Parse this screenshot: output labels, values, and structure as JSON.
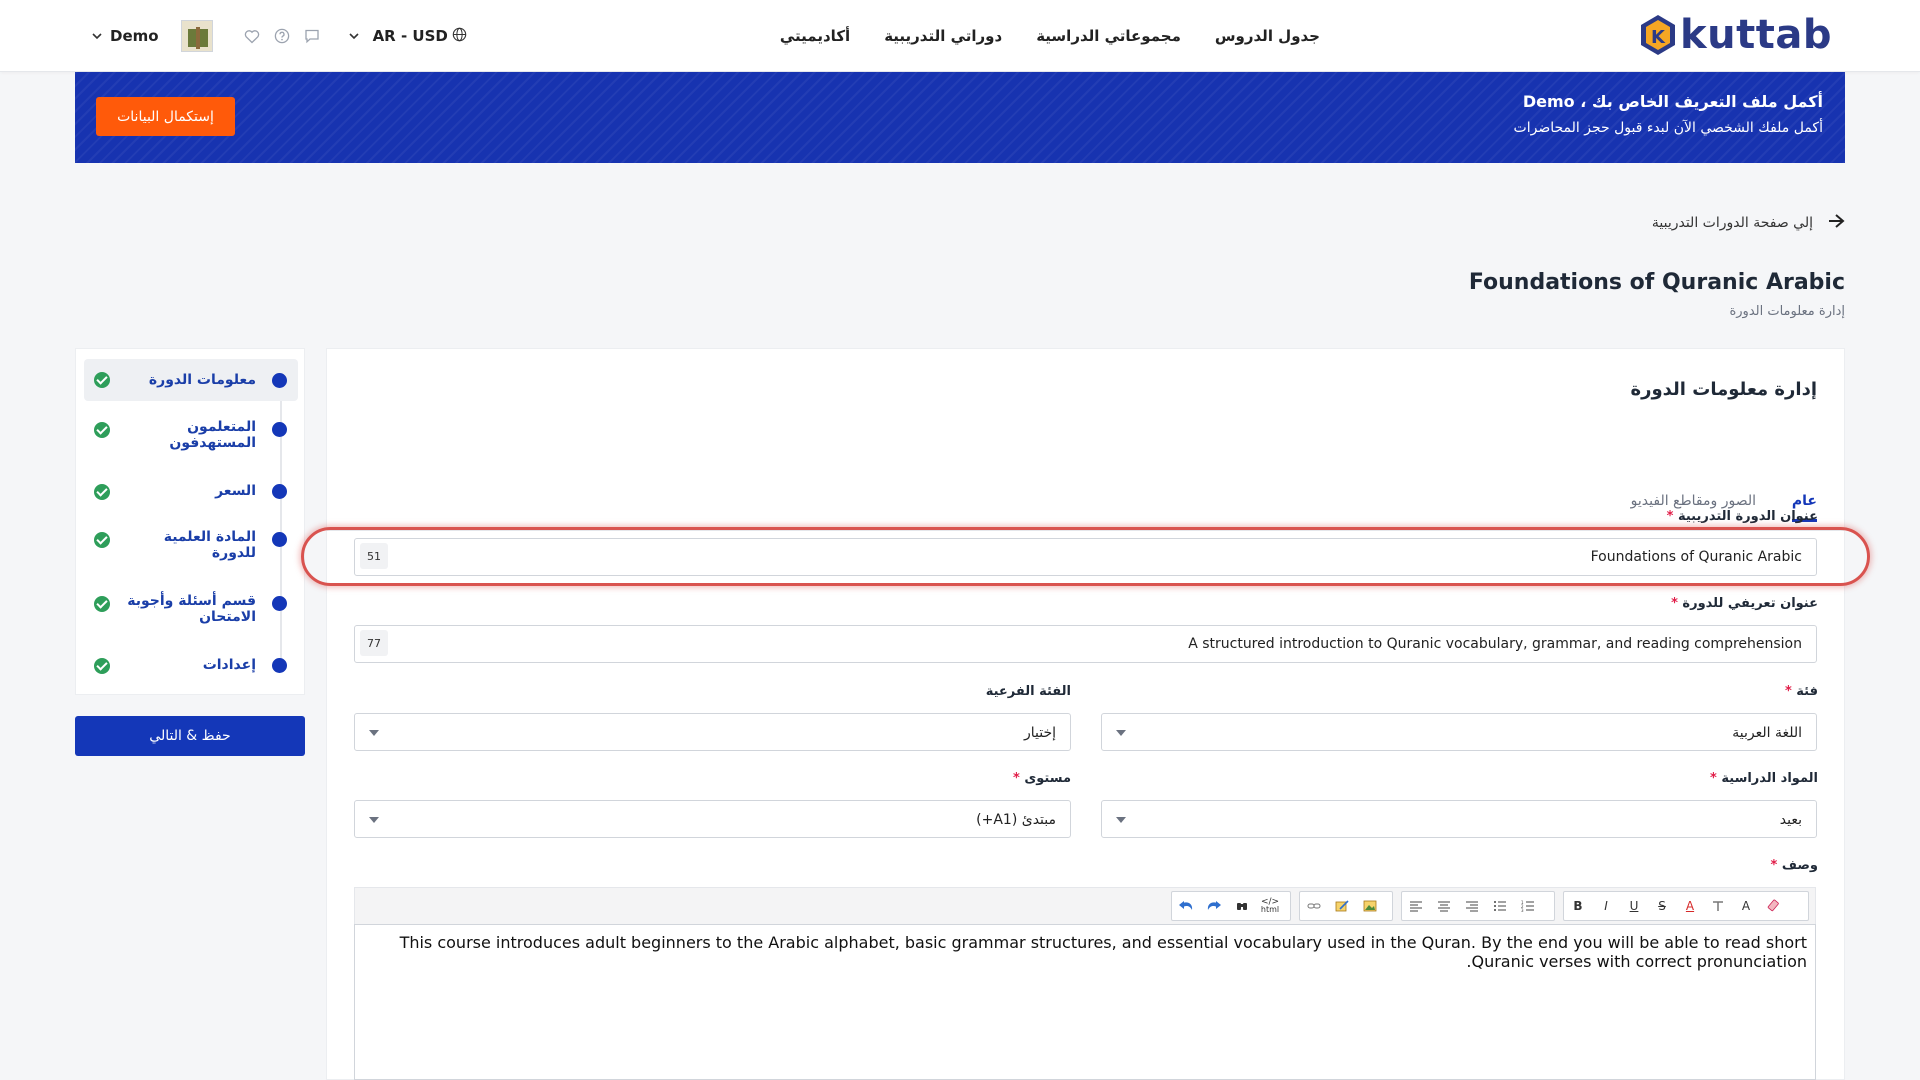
{
  "nav": {
    "logo_text": "kuttab",
    "logo_mark": "K",
    "links": [
      "جدول الدروس",
      "مجموعاتي الدراسية",
      "دوراتي التدريبية",
      "أكاديميتي"
    ],
    "language": "AR - USD",
    "user_name": "Demo",
    "icons": [
      "globe-icon",
      "chat-icon",
      "help-icon",
      "heart-icon",
      "chevron-down-icon"
    ]
  },
  "banner": {
    "title": "أكمل ملف التعريف الخاص بك ، Demo",
    "subtitle": "أكمل ملفك الشخصي الآن لبدء قبول حجز المحاضرات",
    "button": "إستكمال البيانات",
    "bg_color": "#1733b0",
    "button_color": "#ff5a0a"
  },
  "back_link": "إلي صفحة الدورات التدريبية",
  "page": {
    "title": "Foundations of Quranic Arabic",
    "subtitle": "إدارة معلومات الدورة"
  },
  "sidebar": {
    "items": [
      {
        "label": "معلومات الدورة"
      },
      {
        "label": "المتعلمون المستهدفون"
      },
      {
        "label": "السعر"
      },
      {
        "label": "المادة العلمية للدورة"
      },
      {
        "label": "قسم أسئلة وأجوبة الامتحان"
      },
      {
        "label": "إعدادات"
      }
    ],
    "save_button": "حفظ & التالي"
  },
  "card": {
    "title": "إدارة معلومات الدورة",
    "tabs": [
      "عام",
      "الصور ومقاطع الفيديو"
    ]
  },
  "form": {
    "course_title": {
      "label": "عنوان الدورة التدريبية",
      "required": "*",
      "value": "Foundations of Quranic Arabic",
      "counter": "51"
    },
    "course_intro": {
      "label": "عنوان تعريفي للدورة",
      "required": "*",
      "value": "A structured introduction to Quranic vocabulary, grammar, and reading comprehension",
      "counter": "77"
    },
    "category": {
      "label": "فئة",
      "required": "*",
      "value": "اللغة العربية"
    },
    "subcategory": {
      "label": "الفئة الفرعية",
      "value": "إختيار"
    },
    "subjects": {
      "label": "المواد الدراسية",
      "required": "*",
      "value": "بعيد"
    },
    "level": {
      "label": "مستوى",
      "required": "*",
      "value": "مبتدئ (A1+)"
    },
    "description": {
      "label": "وصف",
      "required": "*",
      "text": "This course introduces adult beginners to the Arabic alphabet, basic grammar structures, and essential vocabulary used in the Quran. By the end you will be able to read short Quranic verses with correct pronunciation."
    }
  },
  "toolbar": {
    "bold": "B",
    "italic": "I",
    "underline": "U",
    "strike": "S",
    "font_color": "A",
    "font_size": "A",
    "html": "html"
  }
}
